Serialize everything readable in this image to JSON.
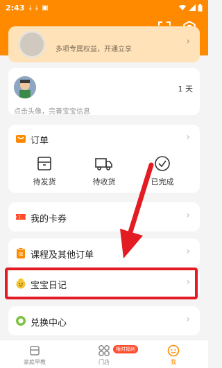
{
  "status_bar": {
    "time": "2:43"
  },
  "vip": {
    "text": "多项专属权益，开通立享"
  },
  "profile": {
    "days": "1 天",
    "hint": "点击头像，完善宝宝信息"
  },
  "orders": {
    "title": "订单",
    "items": [
      {
        "label": "待发货",
        "icon": "package-icon"
      },
      {
        "label": "待收货",
        "icon": "truck-icon"
      },
      {
        "label": "已完成",
        "icon": "check-circle-icon"
      }
    ]
  },
  "menu": [
    {
      "label": "我的卡券",
      "icon": "ticket-icon"
    },
    {
      "label": "课程及其他订单",
      "icon": "clipboard-icon"
    },
    {
      "label": "宝宝日记",
      "icon": "baby-face-icon"
    },
    {
      "label": "兑换中心",
      "icon": "exchange-icon"
    }
  ],
  "tabbar": {
    "tabs": [
      {
        "label": "家庭早教"
      },
      {
        "label": "门店"
      },
      {
        "label": "我"
      }
    ],
    "badge": "限时福利"
  },
  "colors": {
    "brand": "#ff8a00",
    "highlight": "#e31b23"
  }
}
